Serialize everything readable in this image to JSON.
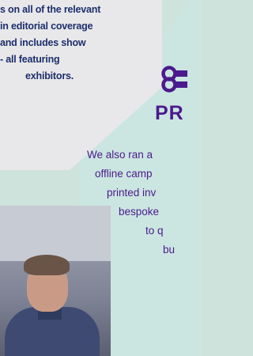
{
  "left_panel": {
    "lines": [
      "s on all of the relevant",
      "in editorial coverage",
      "and includes show",
      "- all featuring",
      "exhibitors."
    ]
  },
  "pr_section": {
    "title": "PR",
    "icon": "pr-logo-icon",
    "body_lines": [
      "We also ran a",
      "offline camp",
      "printed inv",
      "bespoke",
      "to q",
      "bu"
    ]
  },
  "colors": {
    "navy_text": "#1d2e6b",
    "purple_text": "#4b1a8c",
    "grey_panel": "#e8e8ea",
    "teal_panel": "#cbe6e1"
  }
}
